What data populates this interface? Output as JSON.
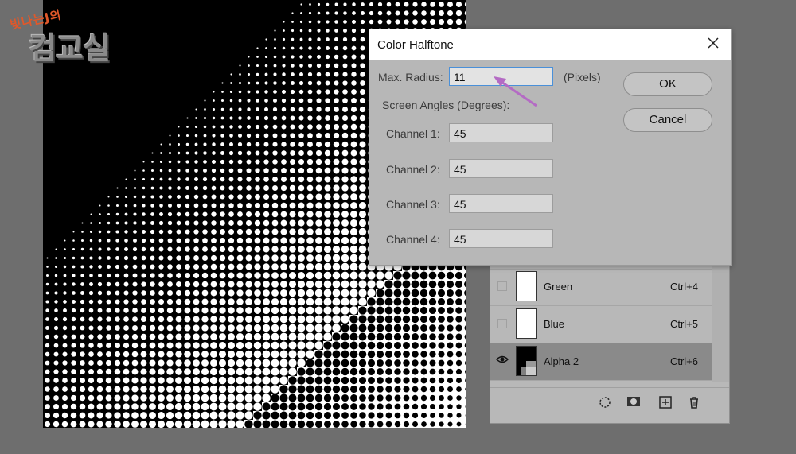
{
  "watermark": {
    "small": "빛나는J의",
    "large": "컴교실"
  },
  "dialog": {
    "title": "Color Halftone",
    "max_radius_label": "Max. Radius:",
    "max_radius_value": "11",
    "unit_label": "(Pixels)",
    "screen_angles_label": "Screen Angles (Degrees):",
    "channels": [
      {
        "label": "Channel 1:",
        "value": "45"
      },
      {
        "label": "Channel 2:",
        "value": "45"
      },
      {
        "label": "Channel 3:",
        "value": "45"
      },
      {
        "label": "Channel 4:",
        "value": "45"
      }
    ],
    "ok_label": "OK",
    "cancel_label": "Cancel"
  },
  "channels_panel": {
    "rows": [
      {
        "name": "Green",
        "shortcut": "Ctrl+4"
      },
      {
        "name": "Blue",
        "shortcut": "Ctrl+5"
      },
      {
        "name": "Alpha 2",
        "shortcut": "Ctrl+6"
      }
    ],
    "footer_icons": [
      "load-selection-icon",
      "save-mask-icon",
      "new-channel-icon",
      "delete-icon"
    ]
  },
  "colors": {
    "accent_arrow": "#b46bc4",
    "field_focus": "#4a90d9"
  }
}
